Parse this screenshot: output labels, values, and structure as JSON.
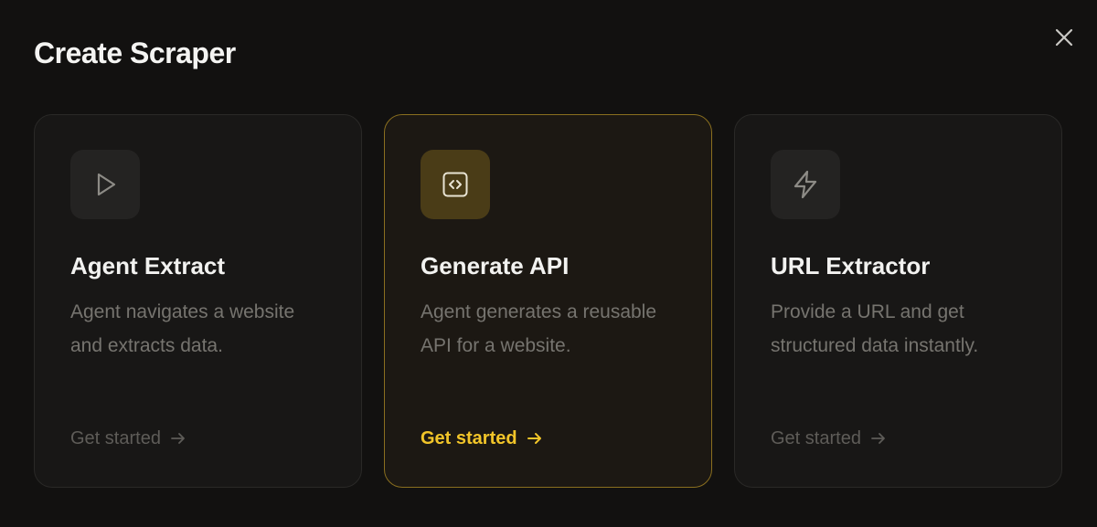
{
  "modal": {
    "title": "Create Scraper",
    "close_icon": "close-icon"
  },
  "colors": {
    "background": "#121110",
    "card": "#181716",
    "accent": "#f2c529",
    "muted_text": "#76746f"
  },
  "cards": [
    {
      "title": "Agent Extract",
      "description": "Agent navigates a website and extracts data.",
      "cta": "Get started",
      "icon": "play-icon",
      "selected": false
    },
    {
      "title": "Generate API",
      "description": "Agent generates a reusable API for a website.",
      "cta": "Get started",
      "icon": "code-icon",
      "selected": true
    },
    {
      "title": "URL Extractor",
      "description": "Provide a URL and get structured data instantly.",
      "cta": "Get started",
      "icon": "lightning-icon",
      "selected": false
    }
  ]
}
